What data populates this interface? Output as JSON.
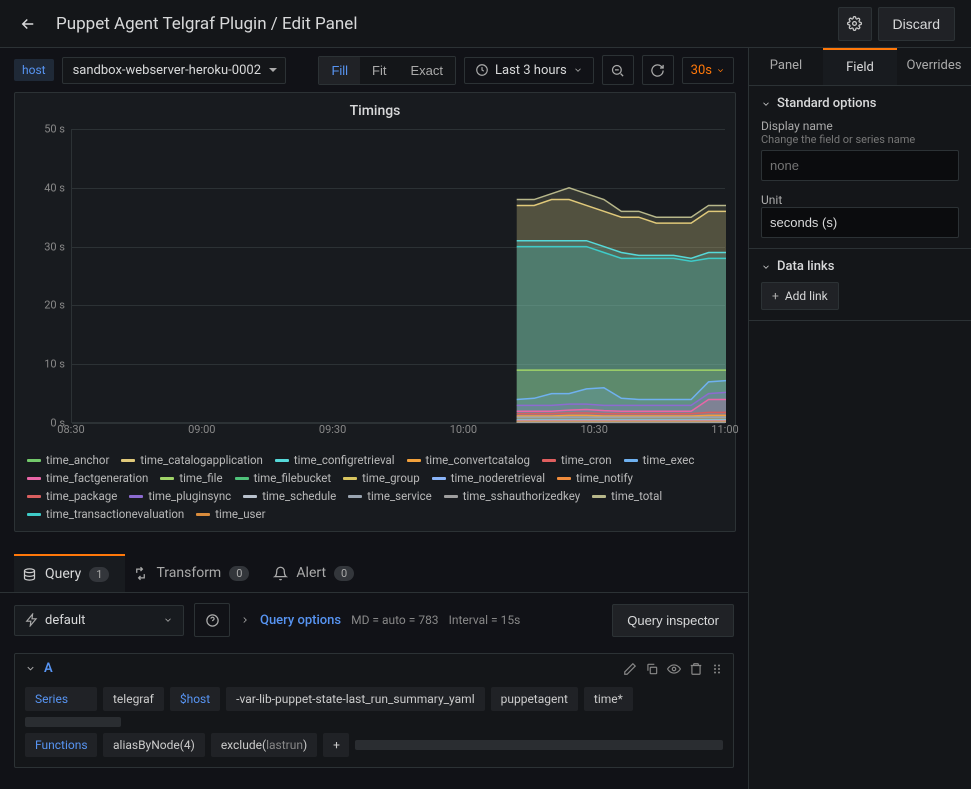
{
  "header": {
    "title": "Puppet Agent Telgraf Plugin / Edit Panel",
    "discard": "Discard"
  },
  "toolbar": {
    "host_label": "host",
    "host_value": "sandbox-webserver-heroku-0002",
    "fit_modes": {
      "fill": "Fill",
      "fit": "Fit",
      "exact": "Exact"
    },
    "time_range": "Last 3 hours",
    "refresh_rate": "30s"
  },
  "panel": {
    "title": "Timings"
  },
  "chart_data": {
    "type": "area-stacked",
    "title": "Timings",
    "xlabel": "",
    "ylabel": "",
    "ylim": [
      0,
      50
    ],
    "yunit": "s",
    "yticks": [
      "0 s",
      "10 s",
      "20 s",
      "30 s",
      "40 s",
      "50 s"
    ],
    "xticks": [
      "08:30",
      "09:00",
      "09:30",
      "10:00",
      "10:30",
      "11:00"
    ],
    "x": [
      "10:15",
      "10:20",
      "10:25",
      "10:30",
      "10:35",
      "10:40",
      "10:45",
      "10:50",
      "10:55",
      "11:00",
      "11:05",
      "11:10",
      "11:15"
    ],
    "series": [
      {
        "name": "time_total",
        "color": "#b7b78a",
        "values": [
          38,
          38,
          39,
          40,
          39,
          38,
          36,
          36,
          35,
          35,
          35,
          37,
          37
        ]
      },
      {
        "name": "time_catalogapplication",
        "color": "#e0c97a",
        "values": [
          37,
          37,
          38,
          38,
          37,
          36,
          35,
          35,
          34,
          34,
          34,
          36,
          36
        ]
      },
      {
        "name": "time_configretrieval",
        "color": "#56d9d9",
        "values": [
          31,
          31,
          31,
          31,
          31,
          30,
          29,
          28.5,
          28.5,
          28.5,
          28,
          29,
          29
        ]
      },
      {
        "name": "time_transactionevaluation",
        "color": "#3ecbc8",
        "values": [
          30,
          30,
          30,
          30,
          30,
          29,
          28,
          28,
          28,
          28,
          27.5,
          28,
          28
        ]
      },
      {
        "name": "time_file",
        "color": "#a0d468",
        "values": [
          9,
          9,
          9,
          9,
          9,
          9,
          9,
          9,
          9,
          9,
          9,
          9,
          9
        ]
      },
      {
        "name": "time_exec",
        "color": "#6fb1f0",
        "values": [
          4,
          4.2,
          5,
          5,
          5.8,
          6,
          4.2,
          4,
          4,
          4,
          4,
          7,
          7.2
        ]
      },
      {
        "name": "time_pluginsync",
        "color": "#8c6bd1",
        "values": [
          3,
          3,
          3,
          3.2,
          3.2,
          3,
          3,
          3,
          3,
          3,
          3,
          5,
          5.2
        ]
      },
      {
        "name": "time_factgeneration",
        "color": "#e966a7",
        "values": [
          2,
          2,
          2,
          2.2,
          2.3,
          2.1,
          2,
          2,
          2,
          2,
          2,
          4,
          4
        ]
      },
      {
        "name": "time_package",
        "color": "#d95f5f",
        "values": [
          1.6,
          1.6,
          1.6,
          1.7,
          1.7,
          1.6,
          1.6,
          1.6,
          1.6,
          1.6,
          1.6,
          1.8,
          1.8
        ]
      },
      {
        "name": "time_convertcatalog",
        "color": "#f2a13c",
        "values": [
          1.2,
          1.2,
          1.2,
          1.3,
          1.3,
          1.2,
          1.2,
          1.2,
          1.2,
          1.2,
          1.2,
          1.3,
          1.3
        ]
      },
      {
        "name": "time_service",
        "color": "#9aa5b1",
        "values": [
          1,
          1,
          1,
          1,
          1,
          1,
          1,
          1,
          1,
          1,
          1,
          1,
          1
        ]
      },
      {
        "name": "time_anchor",
        "color": "#73c96b",
        "values": [
          0.6,
          0.6,
          0.6,
          0.6,
          0.6,
          0.6,
          0.6,
          0.6,
          0.6,
          0.6,
          0.6,
          0.6,
          0.6
        ]
      },
      {
        "name": "time_noderetrieval",
        "color": "#8ab4f8",
        "values": [
          0.5,
          0.5,
          0.5,
          0.5,
          0.5,
          0.5,
          0.5,
          0.5,
          0.5,
          0.5,
          0.5,
          0.5,
          0.5
        ]
      },
      {
        "name": "time_schedule",
        "color": "#b8c1cc",
        "values": [
          0.4,
          0.4,
          0.4,
          0.4,
          0.4,
          0.4,
          0.4,
          0.4,
          0.4,
          0.4,
          0.4,
          0.4,
          0.4
        ]
      },
      {
        "name": "time_cron",
        "color": "#e05f5f",
        "values": [
          0.3,
          0.3,
          0.3,
          0.3,
          0.3,
          0.3,
          0.3,
          0.3,
          0.3,
          0.3,
          0.3,
          0.3,
          0.3
        ]
      },
      {
        "name": "time_notify",
        "color": "#f08c3c",
        "values": [
          0.2,
          0.2,
          0.2,
          0.2,
          0.2,
          0.2,
          0.2,
          0.2,
          0.2,
          0.2,
          0.2,
          0.2,
          0.2
        ]
      },
      {
        "name": "time_user",
        "color": "#d98c3c",
        "values": [
          0.2,
          0.2,
          0.2,
          0.2,
          0.2,
          0.2,
          0.2,
          0.2,
          0.2,
          0.2,
          0.2,
          0.2,
          0.2
        ]
      },
      {
        "name": "time_filebucket",
        "color": "#4fc27a",
        "values": [
          0.1,
          0.1,
          0.1,
          0.1,
          0.1,
          0.1,
          0.1,
          0.1,
          0.1,
          0.1,
          0.1,
          0.1,
          0.1
        ]
      },
      {
        "name": "time_group",
        "color": "#d9c55f",
        "values": [
          0.1,
          0.1,
          0.1,
          0.1,
          0.1,
          0.1,
          0.1,
          0.1,
          0.1,
          0.1,
          0.1,
          0.1,
          0.1
        ]
      },
      {
        "name": "time_sshauthorizedkey",
        "color": "#9e9e9e",
        "values": [
          0.1,
          0.1,
          0.1,
          0.1,
          0.1,
          0.1,
          0.1,
          0.1,
          0.1,
          0.1,
          0.1,
          0.1,
          0.1
        ]
      }
    ],
    "legend_order": [
      "time_anchor",
      "time_catalogapplication",
      "time_configretrieval",
      "time_convertcatalog",
      "time_cron",
      "time_exec",
      "time_factgeneration",
      "time_file",
      "time_filebucket",
      "time_group",
      "time_noderetrieval",
      "time_notify",
      "time_package",
      "time_pluginsync",
      "time_schedule",
      "time_service",
      "time_sshauthorizedkey",
      "time_total",
      "time_transactionevaluation",
      "time_user"
    ]
  },
  "lower": {
    "query_tab": "Query",
    "query_count": "1",
    "transform_tab": "Transform",
    "transform_count": "0",
    "alert_tab": "Alert",
    "alert_count": "0",
    "datasource": "default",
    "query_options": "Query options",
    "md": "MD = auto = 783",
    "interval": "Interval = 15s",
    "inspector": "Query inspector",
    "refid": "A",
    "series_label": "Series",
    "functions_label": "Functions",
    "segs": [
      "telegraf",
      "$host",
      "-var-lib-puppet-state-last_run_summary_yaml",
      "puppetagent",
      "time*"
    ],
    "func1": "aliasByNode(4)",
    "func2_a": "exclude(",
    "func2_b": "lastrun",
    "func2_c": ")"
  },
  "side": {
    "tabs": {
      "panel": "Panel",
      "field": "Field",
      "overrides": "Overrides"
    },
    "standard": "Standard options",
    "display_name": "Display name",
    "display_desc": "Change the field or series name",
    "display_placeholder": "none",
    "unit_label": "Unit",
    "unit_value": "seconds (s)",
    "datalinks": "Data links",
    "add_link": "Add link"
  }
}
